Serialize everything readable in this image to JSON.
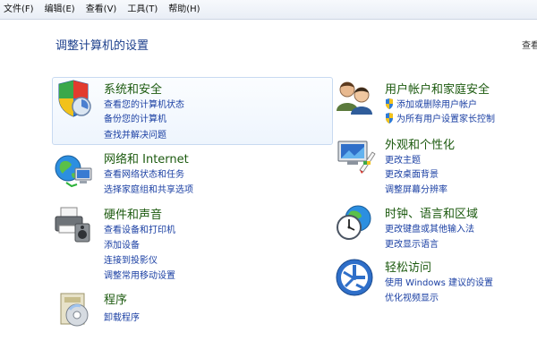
{
  "menubar": {
    "items": [
      "文件(F)",
      "编辑(E)",
      "查看(V)",
      "工具(T)",
      "帮助(H)"
    ]
  },
  "page": {
    "title": "调整计算机的设置",
    "view_by": "查看"
  },
  "categories": {
    "system_security": {
      "title": "系统和安全",
      "links": [
        "查看您的计算机状态",
        "备份您的计算机",
        "查找并解决问题"
      ]
    },
    "network": {
      "title": "网络和 Internet",
      "links": [
        "查看网络状态和任务",
        "选择家庭组和共享选项"
      ]
    },
    "hardware_sound": {
      "title": "硬件和声音",
      "links": [
        "查看设备和打印机",
        "添加设备",
        "连接到投影仪",
        "调整常用移动设置"
      ]
    },
    "programs": {
      "title": "程序",
      "links": [
        "卸载程序"
      ]
    },
    "user_accounts": {
      "title": "用户帐户和家庭安全",
      "links": [
        "添加或删除用户帐户",
        "为所有用户设置家长控制"
      ]
    },
    "appearance": {
      "title": "外观和个性化",
      "links": [
        "更改主题",
        "更改桌面背景",
        "调整屏幕分辨率"
      ]
    },
    "clock_language": {
      "title": "时钟、语言和区域",
      "links": [
        "更改键盘或其他输入法",
        "更改显示语言"
      ]
    },
    "ease_of_access": {
      "title": "轻松访问",
      "links": [
        "使用 Windows 建议的设置",
        "优化视频显示"
      ]
    }
  }
}
